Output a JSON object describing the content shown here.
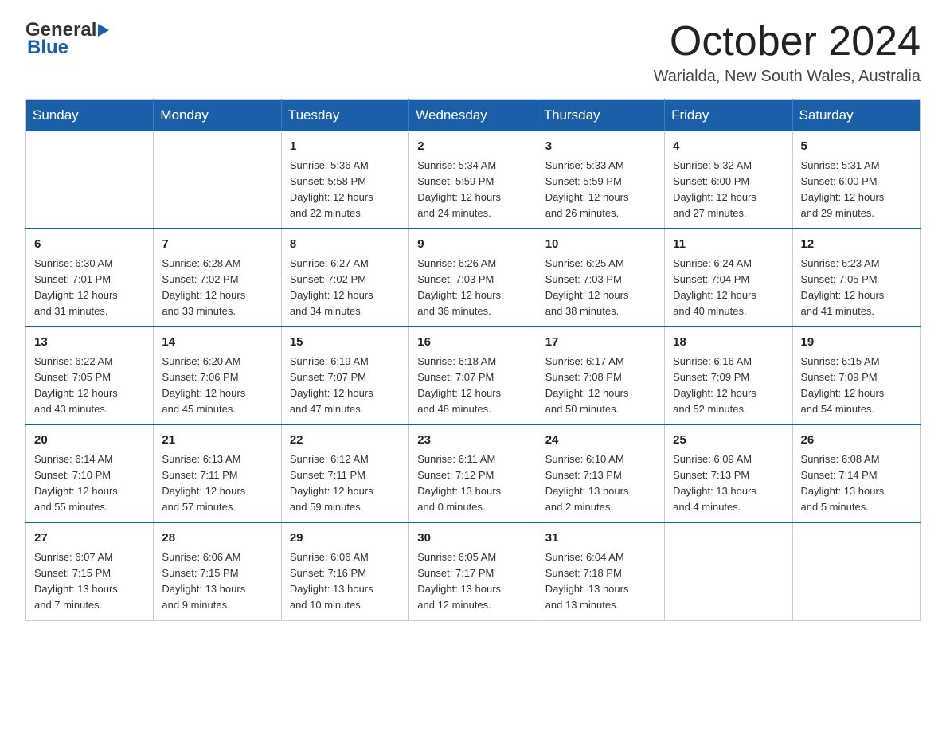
{
  "header": {
    "logo": {
      "general": "General",
      "blue": "Blue"
    },
    "title": "October 2024",
    "location": "Warialda, New South Wales, Australia"
  },
  "calendar": {
    "days_of_week": [
      "Sunday",
      "Monday",
      "Tuesday",
      "Wednesday",
      "Thursday",
      "Friday",
      "Saturday"
    ],
    "weeks": [
      [
        {
          "day": "",
          "info": ""
        },
        {
          "day": "",
          "info": ""
        },
        {
          "day": "1",
          "info": "Sunrise: 5:36 AM\nSunset: 5:58 PM\nDaylight: 12 hours\nand 22 minutes."
        },
        {
          "day": "2",
          "info": "Sunrise: 5:34 AM\nSunset: 5:59 PM\nDaylight: 12 hours\nand 24 minutes."
        },
        {
          "day": "3",
          "info": "Sunrise: 5:33 AM\nSunset: 5:59 PM\nDaylight: 12 hours\nand 26 minutes."
        },
        {
          "day": "4",
          "info": "Sunrise: 5:32 AM\nSunset: 6:00 PM\nDaylight: 12 hours\nand 27 minutes."
        },
        {
          "day": "5",
          "info": "Sunrise: 5:31 AM\nSunset: 6:00 PM\nDaylight: 12 hours\nand 29 minutes."
        }
      ],
      [
        {
          "day": "6",
          "info": "Sunrise: 6:30 AM\nSunset: 7:01 PM\nDaylight: 12 hours\nand 31 minutes."
        },
        {
          "day": "7",
          "info": "Sunrise: 6:28 AM\nSunset: 7:02 PM\nDaylight: 12 hours\nand 33 minutes."
        },
        {
          "day": "8",
          "info": "Sunrise: 6:27 AM\nSunset: 7:02 PM\nDaylight: 12 hours\nand 34 minutes."
        },
        {
          "day": "9",
          "info": "Sunrise: 6:26 AM\nSunset: 7:03 PM\nDaylight: 12 hours\nand 36 minutes."
        },
        {
          "day": "10",
          "info": "Sunrise: 6:25 AM\nSunset: 7:03 PM\nDaylight: 12 hours\nand 38 minutes."
        },
        {
          "day": "11",
          "info": "Sunrise: 6:24 AM\nSunset: 7:04 PM\nDaylight: 12 hours\nand 40 minutes."
        },
        {
          "day": "12",
          "info": "Sunrise: 6:23 AM\nSunset: 7:05 PM\nDaylight: 12 hours\nand 41 minutes."
        }
      ],
      [
        {
          "day": "13",
          "info": "Sunrise: 6:22 AM\nSunset: 7:05 PM\nDaylight: 12 hours\nand 43 minutes."
        },
        {
          "day": "14",
          "info": "Sunrise: 6:20 AM\nSunset: 7:06 PM\nDaylight: 12 hours\nand 45 minutes."
        },
        {
          "day": "15",
          "info": "Sunrise: 6:19 AM\nSunset: 7:07 PM\nDaylight: 12 hours\nand 47 minutes."
        },
        {
          "day": "16",
          "info": "Sunrise: 6:18 AM\nSunset: 7:07 PM\nDaylight: 12 hours\nand 48 minutes."
        },
        {
          "day": "17",
          "info": "Sunrise: 6:17 AM\nSunset: 7:08 PM\nDaylight: 12 hours\nand 50 minutes."
        },
        {
          "day": "18",
          "info": "Sunrise: 6:16 AM\nSunset: 7:09 PM\nDaylight: 12 hours\nand 52 minutes."
        },
        {
          "day": "19",
          "info": "Sunrise: 6:15 AM\nSunset: 7:09 PM\nDaylight: 12 hours\nand 54 minutes."
        }
      ],
      [
        {
          "day": "20",
          "info": "Sunrise: 6:14 AM\nSunset: 7:10 PM\nDaylight: 12 hours\nand 55 minutes."
        },
        {
          "day": "21",
          "info": "Sunrise: 6:13 AM\nSunset: 7:11 PM\nDaylight: 12 hours\nand 57 minutes."
        },
        {
          "day": "22",
          "info": "Sunrise: 6:12 AM\nSunset: 7:11 PM\nDaylight: 12 hours\nand 59 minutes."
        },
        {
          "day": "23",
          "info": "Sunrise: 6:11 AM\nSunset: 7:12 PM\nDaylight: 13 hours\nand 0 minutes."
        },
        {
          "day": "24",
          "info": "Sunrise: 6:10 AM\nSunset: 7:13 PM\nDaylight: 13 hours\nand 2 minutes."
        },
        {
          "day": "25",
          "info": "Sunrise: 6:09 AM\nSunset: 7:13 PM\nDaylight: 13 hours\nand 4 minutes."
        },
        {
          "day": "26",
          "info": "Sunrise: 6:08 AM\nSunset: 7:14 PM\nDaylight: 13 hours\nand 5 minutes."
        }
      ],
      [
        {
          "day": "27",
          "info": "Sunrise: 6:07 AM\nSunset: 7:15 PM\nDaylight: 13 hours\nand 7 minutes."
        },
        {
          "day": "28",
          "info": "Sunrise: 6:06 AM\nSunset: 7:15 PM\nDaylight: 13 hours\nand 9 minutes."
        },
        {
          "day": "29",
          "info": "Sunrise: 6:06 AM\nSunset: 7:16 PM\nDaylight: 13 hours\nand 10 minutes."
        },
        {
          "day": "30",
          "info": "Sunrise: 6:05 AM\nSunset: 7:17 PM\nDaylight: 13 hours\nand 12 minutes."
        },
        {
          "day": "31",
          "info": "Sunrise: 6:04 AM\nSunset: 7:18 PM\nDaylight: 13 hours\nand 13 minutes."
        },
        {
          "day": "",
          "info": ""
        },
        {
          "day": "",
          "info": ""
        }
      ]
    ]
  }
}
